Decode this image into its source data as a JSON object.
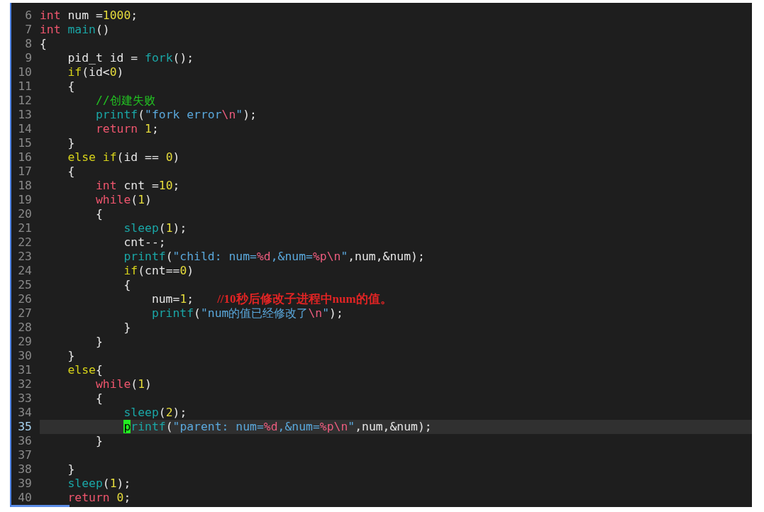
{
  "lines": [
    {
      "number": "6",
      "current": false,
      "tokens": [
        {
          "kind": "keyword",
          "text": "int"
        },
        {
          "kind": "plain",
          "text": " num ="
        },
        {
          "kind": "number",
          "text": "1000"
        },
        {
          "kind": "plain",
          "text": ";"
        }
      ]
    },
    {
      "number": "7",
      "current": false,
      "tokens": [
        {
          "kind": "keyword",
          "text": "int"
        },
        {
          "kind": "function",
          "text": " main"
        },
        {
          "kind": "plain",
          "text": "()"
        }
      ]
    },
    {
      "number": "8",
      "current": false,
      "tokens": [
        {
          "kind": "plain",
          "text": "{"
        }
      ]
    },
    {
      "number": "9",
      "current": false,
      "tokens": [
        {
          "kind": "plain",
          "text": "    pid_t id = "
        },
        {
          "kind": "function",
          "text": "fork"
        },
        {
          "kind": "plain",
          "text": "();"
        }
      ]
    },
    {
      "number": "10",
      "current": false,
      "tokens": [
        {
          "kind": "control",
          "text": "    if"
        },
        {
          "kind": "plain",
          "text": "(id<"
        },
        {
          "kind": "number",
          "text": "0"
        },
        {
          "kind": "plain",
          "text": ")"
        }
      ]
    },
    {
      "number": "11",
      "current": false,
      "tokens": [
        {
          "kind": "plain",
          "text": "    {"
        }
      ]
    },
    {
      "number": "12",
      "current": false,
      "tokens": [
        {
          "kind": "comment",
          "text": "        //创建失败"
        }
      ]
    },
    {
      "number": "13",
      "current": false,
      "tokens": [
        {
          "kind": "function",
          "text": "        printf"
        },
        {
          "kind": "plain",
          "text": "("
        },
        {
          "kind": "string",
          "text": "\"fork error"
        },
        {
          "kind": "escape",
          "text": "\\n"
        },
        {
          "kind": "string",
          "text": "\""
        },
        {
          "kind": "plain",
          "text": ");"
        }
      ]
    },
    {
      "number": "14",
      "current": false,
      "tokens": [
        {
          "kind": "keyword",
          "text": "        return"
        },
        {
          "kind": "number",
          "text": " 1"
        },
        {
          "kind": "plain",
          "text": ";"
        }
      ]
    },
    {
      "number": "15",
      "current": false,
      "tokens": [
        {
          "kind": "plain",
          "text": "    }"
        }
      ]
    },
    {
      "number": "16",
      "current": false,
      "tokens": [
        {
          "kind": "control",
          "text": "    else if"
        },
        {
          "kind": "plain",
          "text": "(id == "
        },
        {
          "kind": "number",
          "text": "0"
        },
        {
          "kind": "plain",
          "text": ")"
        }
      ]
    },
    {
      "number": "17",
      "current": false,
      "tokens": [
        {
          "kind": "plain",
          "text": "    {"
        }
      ]
    },
    {
      "number": "18",
      "current": false,
      "tokens": [
        {
          "kind": "keyword",
          "text": "        int"
        },
        {
          "kind": "plain",
          "text": " cnt ="
        },
        {
          "kind": "number",
          "text": "10"
        },
        {
          "kind": "plain",
          "text": ";"
        }
      ]
    },
    {
      "number": "19",
      "current": false,
      "tokens": [
        {
          "kind": "keyword",
          "text": "        while"
        },
        {
          "kind": "plain",
          "text": "("
        },
        {
          "kind": "number",
          "text": "1"
        },
        {
          "kind": "plain",
          "text": ")"
        }
      ]
    },
    {
      "number": "20",
      "current": false,
      "tokens": [
        {
          "kind": "plain",
          "text": "        {"
        }
      ]
    },
    {
      "number": "21",
      "current": false,
      "tokens": [
        {
          "kind": "function",
          "text": "            sleep"
        },
        {
          "kind": "plain",
          "text": "("
        },
        {
          "kind": "number",
          "text": "1"
        },
        {
          "kind": "plain",
          "text": ");"
        }
      ]
    },
    {
      "number": "22",
      "current": false,
      "tokens": [
        {
          "kind": "plain",
          "text": "            cnt--;"
        }
      ]
    },
    {
      "number": "23",
      "current": false,
      "tokens": [
        {
          "kind": "function",
          "text": "            printf"
        },
        {
          "kind": "plain",
          "text": "("
        },
        {
          "kind": "string",
          "text": "\"child: num="
        },
        {
          "kind": "escape",
          "text": "%d"
        },
        {
          "kind": "string",
          "text": ",&num="
        },
        {
          "kind": "escape",
          "text": "%p\\n"
        },
        {
          "kind": "string",
          "text": "\""
        },
        {
          "kind": "plain",
          "text": ",num,&num);"
        }
      ]
    },
    {
      "number": "24",
      "current": false,
      "tokens": [
        {
          "kind": "control",
          "text": "            if"
        },
        {
          "kind": "plain",
          "text": "(cnt=="
        },
        {
          "kind": "number",
          "text": "0"
        },
        {
          "kind": "plain",
          "text": ")"
        }
      ]
    },
    {
      "number": "25",
      "current": false,
      "tokens": [
        {
          "kind": "plain",
          "text": "            {"
        }
      ]
    },
    {
      "number": "26",
      "current": false,
      "tokens": [
        {
          "kind": "plain",
          "text": "                num="
        },
        {
          "kind": "number",
          "text": "1"
        },
        {
          "kind": "plain",
          "text": ";"
        }
      ],
      "annotation": "//10秒后修改子进程中num的值。"
    },
    {
      "number": "27",
      "current": false,
      "tokens": [
        {
          "kind": "function",
          "text": "                printf"
        },
        {
          "kind": "plain",
          "text": "("
        },
        {
          "kind": "string",
          "text": "\"num的值已经修改了"
        },
        {
          "kind": "escape",
          "text": "\\n"
        },
        {
          "kind": "string",
          "text": "\""
        },
        {
          "kind": "plain",
          "text": ");"
        }
      ]
    },
    {
      "number": "28",
      "current": false,
      "tokens": [
        {
          "kind": "plain",
          "text": "            }"
        }
      ]
    },
    {
      "number": "29",
      "current": false,
      "tokens": [
        {
          "kind": "plain",
          "text": "        }"
        }
      ]
    },
    {
      "number": "30",
      "current": false,
      "tokens": [
        {
          "kind": "plain",
          "text": "    }"
        }
      ]
    },
    {
      "number": "31",
      "current": false,
      "tokens": [
        {
          "kind": "control",
          "text": "    else"
        },
        {
          "kind": "plain",
          "text": "{"
        }
      ]
    },
    {
      "number": "32",
      "current": false,
      "tokens": [
        {
          "kind": "keyword",
          "text": "        while"
        },
        {
          "kind": "plain",
          "text": "("
        },
        {
          "kind": "number",
          "text": "1"
        },
        {
          "kind": "plain",
          "text": ")"
        }
      ]
    },
    {
      "number": "33",
      "current": false,
      "tokens": [
        {
          "kind": "plain",
          "text": "        {"
        }
      ]
    },
    {
      "number": "34",
      "current": false,
      "tokens": [
        {
          "kind": "function",
          "text": "            sleep"
        },
        {
          "kind": "plain",
          "text": "("
        },
        {
          "kind": "number",
          "text": "2"
        },
        {
          "kind": "plain",
          "text": ");"
        }
      ]
    },
    {
      "number": "35",
      "current": true,
      "tokens": [
        {
          "kind": "function",
          "text": "            printf",
          "cursor": true
        },
        {
          "kind": "plain",
          "text": "("
        },
        {
          "kind": "string",
          "text": "\"parent: num="
        },
        {
          "kind": "escape",
          "text": "%d"
        },
        {
          "kind": "string",
          "text": ",&num="
        },
        {
          "kind": "escape",
          "text": "%p\\n"
        },
        {
          "kind": "string",
          "text": "\""
        },
        {
          "kind": "plain",
          "text": ",num,&num);"
        }
      ]
    },
    {
      "number": "36",
      "current": false,
      "tokens": [
        {
          "kind": "plain",
          "text": "        }"
        }
      ]
    },
    {
      "number": "37",
      "current": false
    },
    {
      "number": "38",
      "current": false,
      "tokens": [
        {
          "kind": "plain",
          "text": "    }"
        }
      ]
    },
    {
      "number": "39",
      "current": false,
      "tokens": [
        {
          "kind": "function",
          "text": "    sleep"
        },
        {
          "kind": "plain",
          "text": "("
        },
        {
          "kind": "number",
          "text": "1"
        },
        {
          "kind": "plain",
          "text": ");"
        }
      ]
    },
    {
      "number": "40",
      "current": false,
      "tokens": [
        {
          "kind": "keyword",
          "text": "    return"
        },
        {
          "kind": "number",
          "text": " 0"
        },
        {
          "kind": "plain",
          "text": ";"
        }
      ]
    }
  ]
}
